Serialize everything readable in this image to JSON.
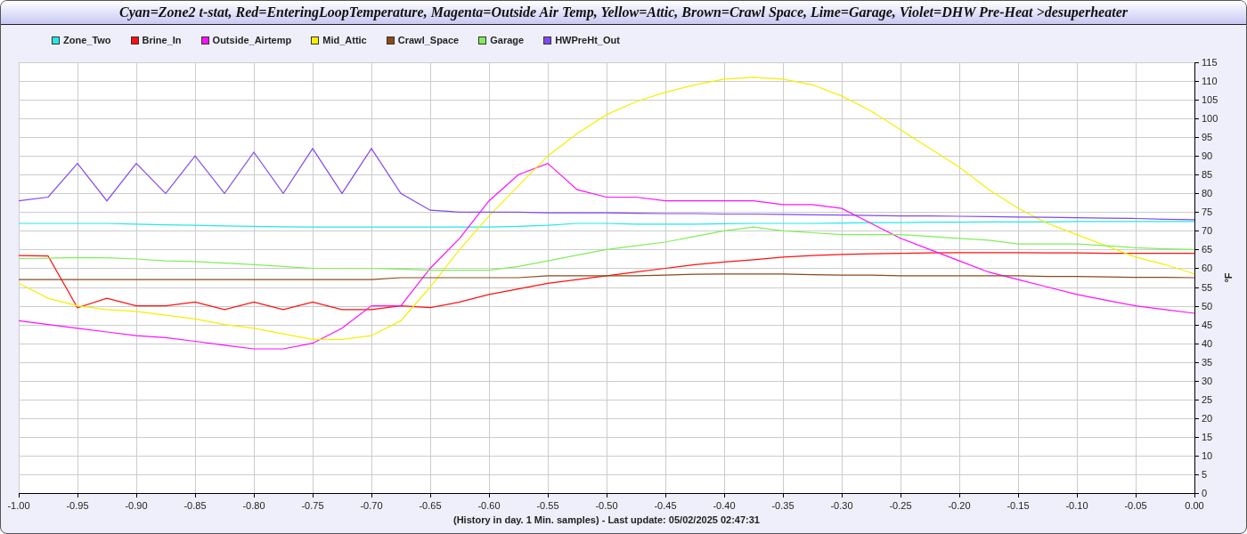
{
  "chart_data": {
    "type": "line",
    "title": "Cyan=Zone2 t-stat, Red=EnteringLoopTemperature, Magenta=Outside Air Temp, Yellow=Attic, Brown=Crawl Space, Lime=Garage, Violet=DHW Pre-Heat >desuperheater",
    "xlabel": "(History in day. 1 Min. samples) - Last update: 05/02/2025 02:47:31",
    "ylabel": "°F",
    "x": [
      -1,
      -0.975,
      -0.95,
      -0.925,
      -0.9,
      -0.875,
      -0.85,
      -0.825,
      -0.8,
      -0.775,
      -0.75,
      -0.725,
      -0.7,
      -0.675,
      -0.65,
      -0.625,
      -0.6,
      -0.575,
      -0.55,
      -0.525,
      -0.5,
      -0.475,
      -0.45,
      -0.425,
      -0.4,
      -0.375,
      -0.35,
      -0.325,
      -0.3,
      -0.275,
      -0.25,
      -0.225,
      -0.2,
      -0.175,
      -0.15,
      -0.125,
      -0.1,
      -0.075,
      -0.05,
      -0.025,
      0
    ],
    "series": [
      {
        "name": "Zone_Two",
        "color": "#22e8e8",
        "values": [
          72,
          72,
          72,
          72,
          71.8,
          71.6,
          71.5,
          71.3,
          71.2,
          71.1,
          71,
          71,
          71,
          71,
          71,
          71,
          71,
          71.2,
          71.5,
          72,
          72,
          71.8,
          71.8,
          71.8,
          71.9,
          72,
          72,
          72,
          72.1,
          72.2,
          72.2,
          72.3,
          72.3,
          72.4,
          72.4,
          72.4,
          72.5,
          72.5,
          72.5,
          72.5,
          72.5
        ]
      },
      {
        "name": "Brine_In",
        "color": "#ff1010",
        "values": [
          63.4,
          63.3,
          49.5,
          52,
          50,
          50,
          51,
          49,
          51,
          49,
          51,
          49,
          49,
          50,
          49.5,
          51,
          53,
          54.5,
          56,
          57,
          58,
          59,
          60,
          61,
          61.7,
          62.3,
          63,
          63.4,
          63.7,
          63.9,
          64,
          64.1,
          64.2,
          64.2,
          64.2,
          64.1,
          64.1,
          64,
          64,
          64,
          64
        ]
      },
      {
        "name": "Outside_Airtemp",
        "color": "#ff10ff",
        "values": [
          46,
          45,
          44,
          43,
          42,
          41.5,
          40.5,
          39.5,
          38.5,
          38.5,
          40,
          44,
          50,
          50,
          60,
          68,
          78,
          85,
          88,
          81,
          79,
          79,
          78,
          78,
          78,
          78,
          77,
          77,
          76,
          72,
          68,
          65,
          62,
          59,
          57,
          55,
          53,
          51.5,
          50,
          49,
          48
        ]
      },
      {
        "name": "Mid_Attic",
        "color": "#f4f000",
        "values": [
          56,
          52,
          50,
          49,
          48.5,
          47.5,
          46.5,
          45,
          44,
          42.5,
          41,
          41,
          42,
          46,
          55,
          65,
          74,
          82,
          90,
          96,
          101,
          104.5,
          107,
          109,
          110.5,
          111,
          110.5,
          109,
          106,
          102,
          97,
          92,
          87,
          81,
          76,
          72,
          69,
          66,
          63,
          61,
          58.5
        ]
      },
      {
        "name": "Crawl_Space",
        "color": "#8b4a1a",
        "values": [
          57,
          57,
          57,
          57,
          57,
          57,
          57,
          57,
          57,
          57,
          57,
          57,
          57,
          57.5,
          57.5,
          57.5,
          57.5,
          57.5,
          58,
          58,
          58,
          58,
          58.2,
          58.4,
          58.5,
          58.5,
          58.5,
          58.3,
          58.2,
          58.2,
          58,
          58,
          58,
          58,
          58,
          57.8,
          57.8,
          57.7,
          57.6,
          57.6,
          57.5
        ]
      },
      {
        "name": "Garage",
        "color": "#80ee58",
        "values": [
          62.6,
          62.7,
          62.9,
          62.8,
          62.5,
          62,
          61.8,
          61.4,
          61,
          60.5,
          60,
          60,
          60,
          59.8,
          59.5,
          59.5,
          59.5,
          60.5,
          62,
          63.5,
          65,
          66,
          67,
          68.5,
          70,
          71,
          70,
          69.5,
          69,
          69,
          69,
          68.5,
          68,
          67.5,
          66.5,
          66.5,
          66.5,
          66,
          65.5,
          65.2,
          65
        ]
      },
      {
        "name": "HWPreHt_Out",
        "color": "#8048f0",
        "values": [
          78,
          79,
          88,
          78,
          88,
          80,
          90,
          80,
          91,
          80,
          92,
          80,
          92,
          80,
          75.5,
          75,
          75,
          75,
          74.8,
          74.8,
          74.8,
          74.7,
          74.6,
          74.6,
          74.5,
          74.5,
          74.4,
          74.3,
          74.2,
          74.1,
          74,
          74,
          73.9,
          73.8,
          73.7,
          73.6,
          73.5,
          73.4,
          73.3,
          73.1,
          73
        ]
      }
    ],
    "grid": true,
    "legend": "top",
    "xlim": [
      -1,
      0
    ],
    "ylim": [
      0,
      115
    ],
    "xticks": [
      {
        "value": -1,
        "label": "-1.00"
      },
      {
        "value": -0.95,
        "label": "-0.95"
      },
      {
        "value": -0.9,
        "label": "-0.90"
      },
      {
        "value": -0.85,
        "label": "-0.85"
      },
      {
        "value": -0.8,
        "label": "-0.80"
      },
      {
        "value": -0.75,
        "label": "-0.75"
      },
      {
        "value": -0.7,
        "label": "-0.70"
      },
      {
        "value": -0.65,
        "label": "-0.65"
      },
      {
        "value": -0.6,
        "label": "-0.60"
      },
      {
        "value": -0.55,
        "label": "-0.55"
      },
      {
        "value": -0.5,
        "label": "-0.50"
      },
      {
        "value": -0.45,
        "label": "-0.45"
      },
      {
        "value": -0.4,
        "label": "-0.40"
      },
      {
        "value": -0.35,
        "label": "-0.35"
      },
      {
        "value": -0.3,
        "label": "-0.30"
      },
      {
        "value": -0.25,
        "label": "-0.25"
      },
      {
        "value": -0.2,
        "label": "-0.20"
      },
      {
        "value": -0.15,
        "label": "-0.15"
      },
      {
        "value": -0.1,
        "label": "-0.10"
      },
      {
        "value": -0.05,
        "label": "-0.05"
      },
      {
        "value": 0,
        "label": "0.00"
      }
    ],
    "yticks": [
      0,
      5,
      10,
      15,
      20,
      25,
      30,
      35,
      40,
      45,
      50,
      55,
      60,
      65,
      70,
      75,
      80,
      85,
      90,
      95,
      100,
      105,
      110,
      115
    ]
  }
}
